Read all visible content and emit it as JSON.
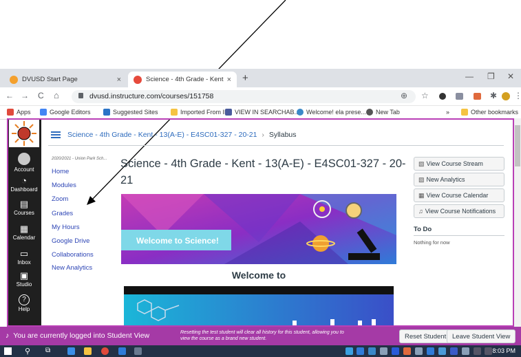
{
  "tabs": [
    {
      "title": "DVUSD Start Page",
      "close": "×",
      "color": "#f4a02d"
    },
    {
      "title": "Science - 4th Grade - Kent - 13(A",
      "close": "×",
      "color": "#e64a3c"
    }
  ],
  "new_tab": "+",
  "window_controls": {
    "minimize": "—",
    "restore": "❐",
    "close": "✕"
  },
  "address": {
    "url": "dvusd.instructure.com/courses/151758",
    "back": "←",
    "forward": "→",
    "reload": "C",
    "home": "⌂"
  },
  "bookmarks": [
    {
      "label": "Apps",
      "color": "#e04a3c"
    },
    {
      "label": "Google Editors",
      "color": "#4285f4"
    },
    {
      "label": "Suggested Sites",
      "color": "#2b74c7"
    },
    {
      "label": "Imported From IE",
      "color": "#f5c342"
    },
    {
      "label": "VIEW IN SEARCHAB...",
      "color": "#4a5b9c"
    },
    {
      "label": "Welcome! ela prese...",
      "color": "#3a88c8"
    },
    {
      "label": "New Tab",
      "color": "#555555"
    }
  ],
  "bookmarks_more": "»",
  "other_bookmarks": "Other bookmarks",
  "global_nav": [
    {
      "label": "Account",
      "icon": "account-icon",
      "glyph": "●"
    },
    {
      "label": "Dashboard",
      "icon": "dashboard-icon",
      "glyph": "◔"
    },
    {
      "label": "Courses",
      "icon": "courses-icon",
      "glyph": "▤"
    },
    {
      "label": "Calendar",
      "icon": "calendar-icon",
      "glyph": "▦"
    },
    {
      "label": "Inbox",
      "icon": "inbox-icon",
      "glyph": "▭"
    },
    {
      "label": "Studio",
      "icon": "studio-icon",
      "glyph": "▣"
    },
    {
      "label": "Help",
      "icon": "help-icon",
      "glyph": "?"
    }
  ],
  "breadcrumb": {
    "course": "Science - 4th Grade - Kent - 13(A-E) - E4SC01-327 - 20-21",
    "sep": "›",
    "page": "Syllabus"
  },
  "term": "2020/2021 - Union Park Sch...",
  "course_nav": [
    "Home",
    "Modules",
    "Zoom",
    "Grades",
    "My Hours",
    "Google Drive",
    "Collaborations",
    "New Analytics"
  ],
  "course_title": "Science - 4th Grade - Kent - 13(A-E) - E4SC01-327 - 20-21",
  "banner_text": "Welcome to Science!",
  "welcome_heading": "Welcome to",
  "right_buttons": [
    {
      "label": "View Course Stream",
      "icon": "stream-icon"
    },
    {
      "label": "New Analytics",
      "icon": "analytics-icon"
    },
    {
      "label": "View Course Calendar",
      "icon": "calendar-icon"
    },
    {
      "label": "View Course Notifications",
      "icon": "bell-icon"
    }
  ],
  "todo": {
    "heading": "To Do",
    "empty": "Nothing for now"
  },
  "student_view": {
    "message": "You are currently logged into Student View",
    "note": "Resetting the test student will clear all history for this student, allowing you to view the course as a brand new student.",
    "reset": "Reset Student",
    "leave": "Leave Student View"
  },
  "clock": "8:03 PM",
  "colors": {
    "accent": "#a53aa6",
    "link": "#2d45b5",
    "global_nav": "#1f1f1f"
  }
}
